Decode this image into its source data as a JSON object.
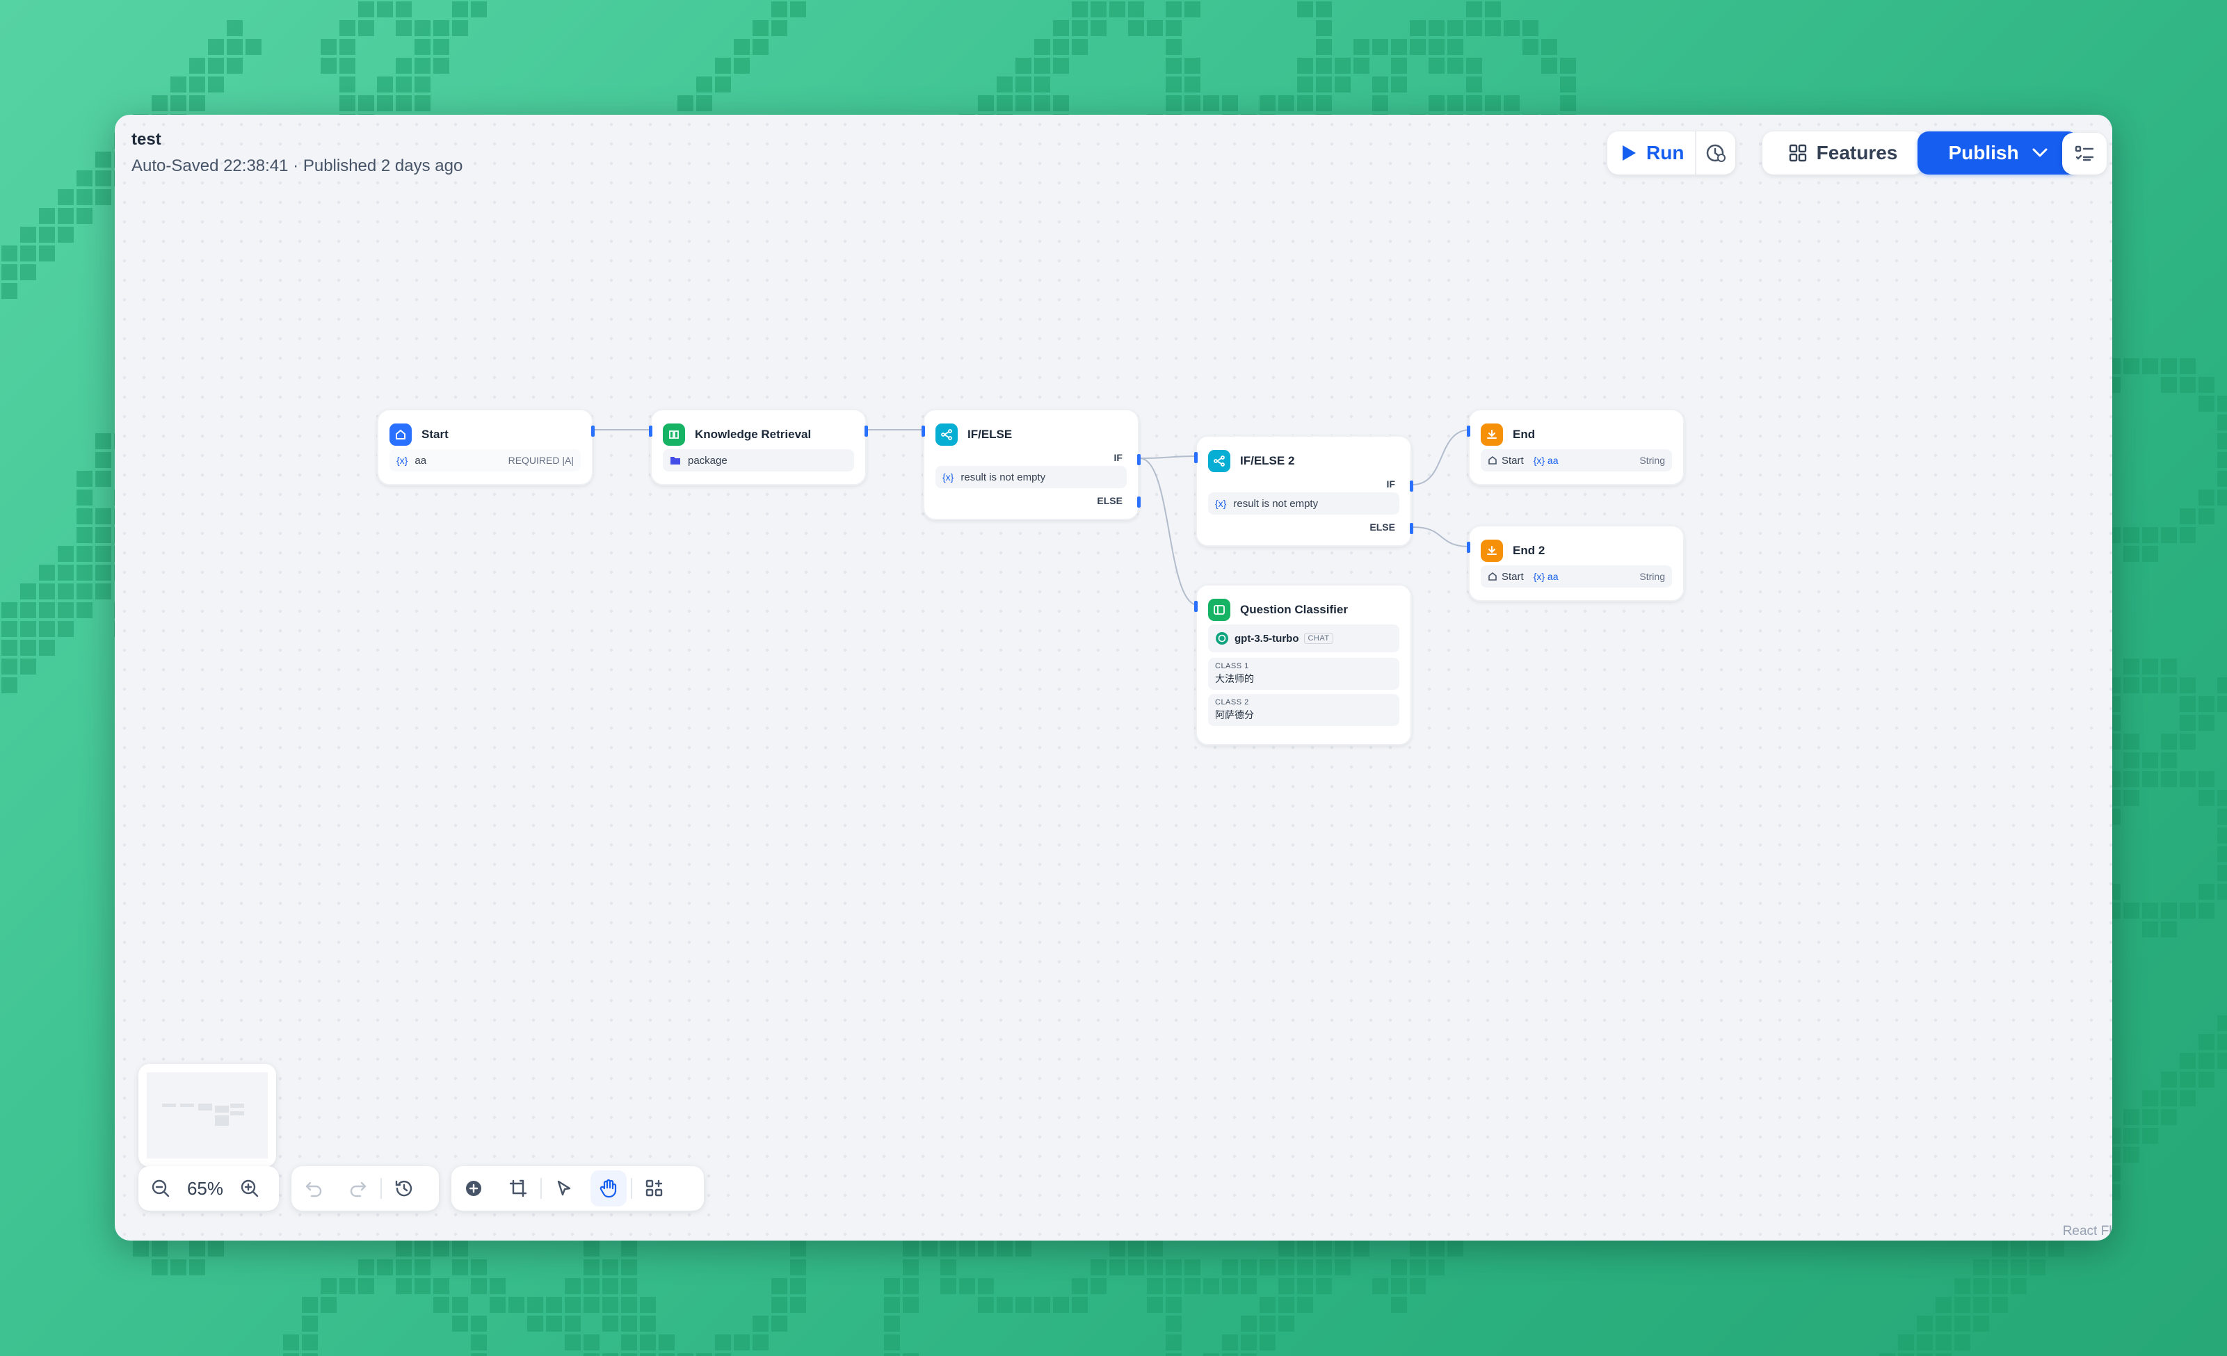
{
  "window": {
    "title": "test",
    "status": "Auto-Saved 22:38:41 · Published 2 days ago"
  },
  "toolbar": {
    "run_label": "Run",
    "features_label": "Features",
    "publish_label": "Publish"
  },
  "nodes": {
    "start": {
      "title": "Start",
      "var_prefix": "{x}",
      "var_name": "aa",
      "tag": "REQUIRED |A|"
    },
    "knowledge": {
      "title": "Knowledge Retrieval",
      "dataset": "package"
    },
    "ifelse1": {
      "title": "IF/ELSE",
      "if_label": "IF",
      "condition": "result is not empty",
      "else_label": "ELSE"
    },
    "ifelse2": {
      "title": "IF/ELSE 2",
      "if_label": "IF",
      "condition": "result is not empty",
      "else_label": "ELSE"
    },
    "end1": {
      "title": "End",
      "source": "Start",
      "var": "{x} aa",
      "type": "String"
    },
    "end2": {
      "title": "End 2",
      "source": "Start",
      "var": "{x} aa",
      "type": "String"
    },
    "classifier": {
      "title": "Question Classifier",
      "model": "gpt-3.5-turbo",
      "model_tag": "CHAT",
      "classes": [
        {
          "label": "CLASS 1",
          "value": "大法师的"
        },
        {
          "label": "CLASS 2",
          "value": "阿萨德分"
        }
      ]
    }
  },
  "zoom": {
    "level": "65%"
  },
  "watermark": "React Flo",
  "colors": {
    "accent": "#155eef",
    "start_icon": "#2970ff",
    "knowledge_icon": "#16b364",
    "ifelse_icon": "#06aed4",
    "end_icon": "#f79009",
    "classifier_icon": "#16b364"
  }
}
